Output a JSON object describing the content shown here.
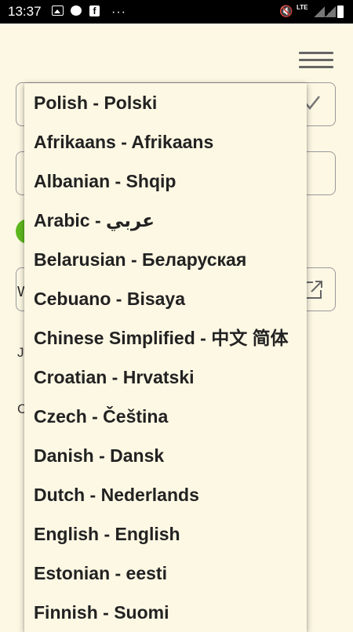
{
  "status_bar": {
    "time": "13:37",
    "left_icons": [
      "photo-icon",
      "messenger-icon",
      "facebook-icon",
      "more-dots-icon"
    ],
    "right_icons": [
      "mute-icon",
      "lte-icon",
      "signal-icon",
      "signal-icon",
      "battery-icon"
    ],
    "lte_label": "LTE"
  },
  "background": {
    "w_text": "W",
    "j_text": "J",
    "c_text": "C"
  },
  "language_dropdown": {
    "items": [
      "Polish - Polski",
      "Afrikaans - Afrikaans",
      "Albanian - Shqip",
      "Arabic - عربي",
      "Belarusian - Беларуская",
      "Cebuano - Bisaya",
      "Chinese Simplified - 中文 简体",
      "Croatian - Hrvatski",
      "Czech - Čeština",
      "Danish - Dansk",
      "Dutch - Nederlands",
      "English - English",
      "Estonian - eesti",
      "Finnish - Suomi"
    ]
  },
  "colors": {
    "background": "#fdf8e4",
    "status_bar": "#000000",
    "accent_green": "#5fb91e",
    "text": "#222222"
  }
}
